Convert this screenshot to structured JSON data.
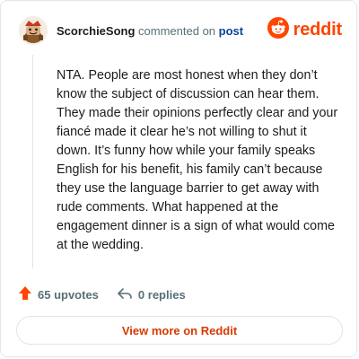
{
  "header": {
    "username": "ScorchieSong",
    "action_text": "commented on",
    "post_link": "post",
    "avatar_icon": "user-avatar-icon"
  },
  "brand": {
    "wordmark": "reddit",
    "logo_icon": "reddit-snoo-icon",
    "color": "#ff4500"
  },
  "comment": {
    "text": "NTA. People are most honest when they don’t know the subject of discussion can hear them. They made their opinions perfectly clear and your fiancé made it clear he’s not willing to shut it down. It’s funny how while your family speaks English for his benefit, his family can’t because they use the language barrier to get away with rude comments. What happened at the engagement dinner is a sign of what would come at the wedding."
  },
  "actions": {
    "upvotes_label": "65 upvotes",
    "upvote_icon": "upvote-arrow-icon",
    "replies_label": "0 replies",
    "reply_icon": "reply-arrow-icon"
  },
  "footer": {
    "view_more_label": "View more on Reddit",
    "accent": "#d93900"
  }
}
